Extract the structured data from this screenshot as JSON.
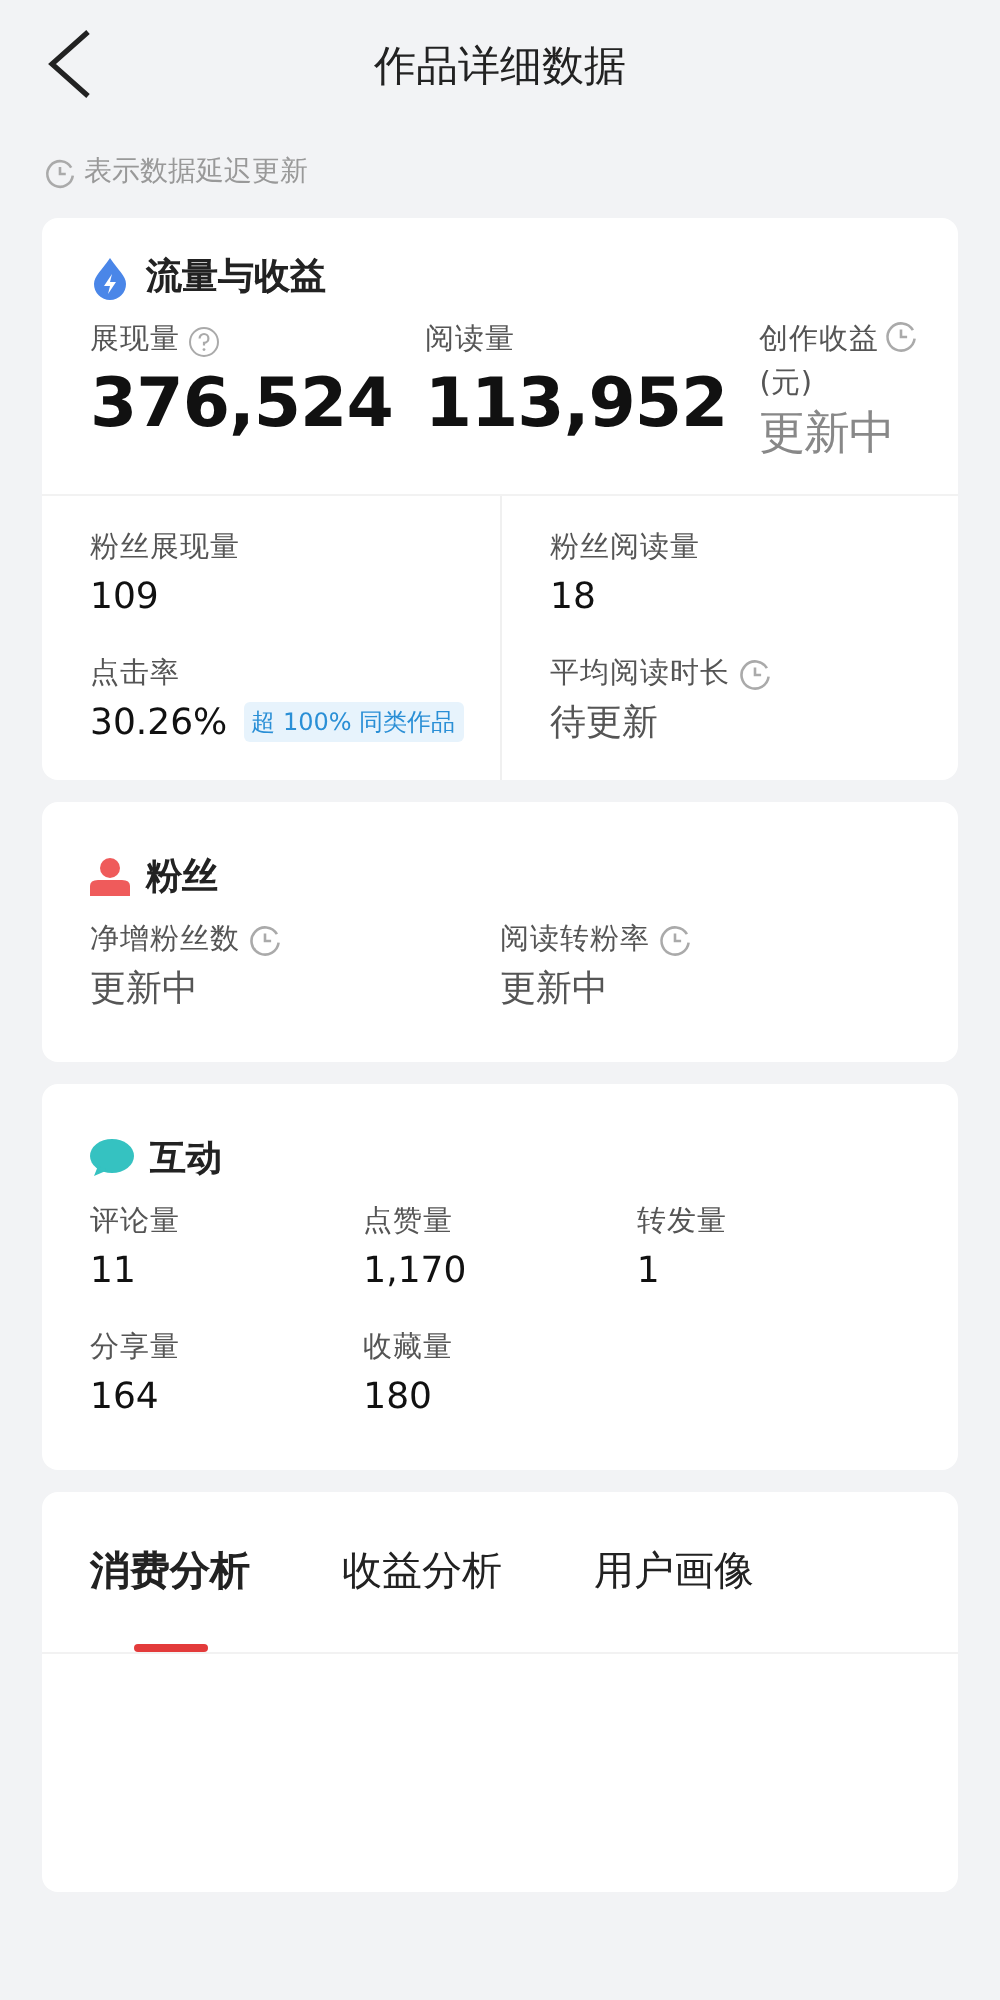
{
  "header": {
    "title": "作品详细数据"
  },
  "notice": {
    "text": "表示数据延迟更新"
  },
  "traffic": {
    "title": "流量与收益",
    "main_metrics": [
      {
        "label": "展现量",
        "value": "376,524",
        "info": true,
        "delayed": false,
        "pending": false
      },
      {
        "label": "阅读量",
        "value": "113,952",
        "info": false,
        "delayed": false,
        "pending": false
      },
      {
        "label": "创作收益(元)",
        "value": "更新中",
        "info": false,
        "delayed": true,
        "pending": true
      }
    ],
    "sub_metrics": [
      {
        "label": "粉丝展现量",
        "value": "109",
        "delayed": false,
        "pending": false
      },
      {
        "label": "粉丝阅读量",
        "value": "18",
        "delayed": false,
        "pending": false
      },
      {
        "label": "点击率",
        "value": "30.26%",
        "badge": "超 100% 同类作品",
        "delayed": false,
        "pending": false
      },
      {
        "label": "平均阅读时长",
        "value": "待更新",
        "delayed": true,
        "pending": true
      }
    ]
  },
  "fans": {
    "title": "粉丝",
    "metrics": [
      {
        "label": "净增粉丝数",
        "value": "更新中",
        "delayed": true,
        "pending": true
      },
      {
        "label": "阅读转粉率",
        "value": "更新中",
        "delayed": true,
        "pending": true
      }
    ]
  },
  "interaction": {
    "title": "互动",
    "metrics": [
      {
        "label": "评论量",
        "value": "11",
        "delayed": false,
        "pending": false
      },
      {
        "label": "点赞量",
        "value": "1,170",
        "delayed": false,
        "pending": false
      },
      {
        "label": "转发量",
        "value": "1",
        "delayed": false,
        "pending": false
      },
      {
        "label": "分享量",
        "value": "164",
        "delayed": false,
        "pending": false
      },
      {
        "label": "收藏量",
        "value": "180",
        "delayed": false,
        "pending": false
      }
    ]
  },
  "tabs": [
    {
      "label": "消费分析",
      "selected": true
    },
    {
      "label": "收益分析",
      "selected": false
    },
    {
      "label": "用户画像",
      "selected": false
    }
  ]
}
